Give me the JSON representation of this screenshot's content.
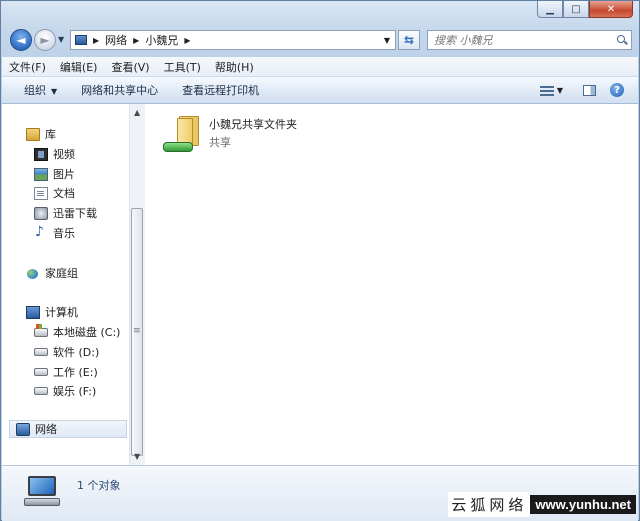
{
  "caption_buttons": {
    "minimize": "▁",
    "maximize": "□",
    "close": "✕"
  },
  "address": {
    "breadcrumbs": [
      "网络",
      "小魏兄"
    ],
    "search_placeholder": "搜索 小魏兄"
  },
  "menubar": [
    {
      "label": "文件(F)"
    },
    {
      "label": "编辑(E)"
    },
    {
      "label": "查看(V)"
    },
    {
      "label": "工具(T)"
    },
    {
      "label": "帮助(H)"
    }
  ],
  "commandbar": {
    "organize": "组织",
    "network_center": "网络和共享中心",
    "remote_printers": "查看远程打印机"
  },
  "navigation": {
    "libraries": "库",
    "video": "视频",
    "pictures": "图片",
    "documents": "文档",
    "thunder": "迅雷下载",
    "music": "音乐",
    "homegroup": "家庭组",
    "computer": "计算机",
    "drive_c": "本地磁盘 (C:)",
    "drive_d": "软件 (D:)",
    "drive_e": "工作 (E:)",
    "drive_f": "娱乐 (F:)",
    "network": "网络"
  },
  "content": {
    "items": [
      {
        "name": "小魏兄共享文件夹",
        "type": "共享"
      }
    ]
  },
  "details": {
    "count": "1 个对象"
  },
  "watermark": {
    "text": "云狐网络",
    "url": "www.yunhu.net"
  }
}
